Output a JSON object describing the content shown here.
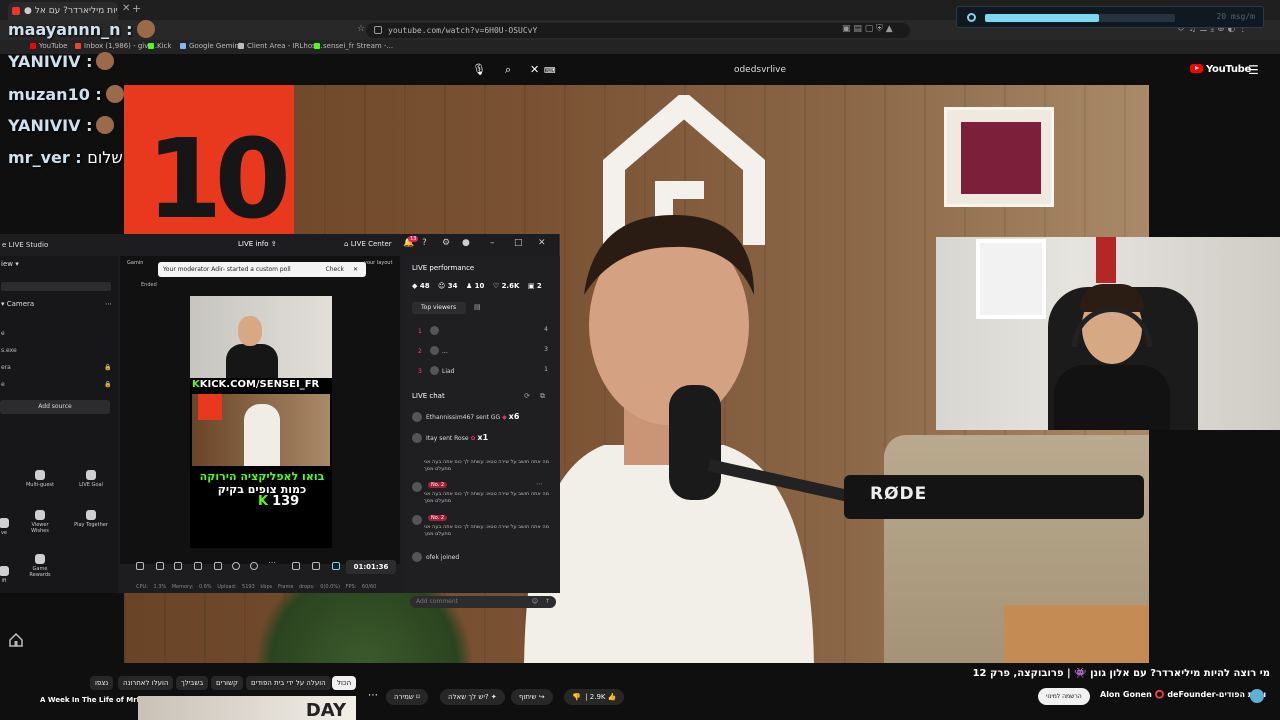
{
  "browser": {
    "tab_title": "● מי רוצה להיות מיליארדר? עם אל",
    "url": "youtube.com/watch?v=6H0U-OSUCvY",
    "bookmarks": [
      {
        "label": "YouTube",
        "color": "#ff0000"
      },
      {
        "label": "Inbox (1,986) - givo...",
        "color": "#ea4335"
      },
      {
        "label": "Kick",
        "color": "#53fc18"
      },
      {
        "label": "Google Gemini",
        "color": "#8ab4f8"
      },
      {
        "label": "Client Area - IRLhos...",
        "color": "#bbbbbb"
      },
      {
        "label": "sensei_fr Stream -...",
        "color": "#53fc18"
      }
    ]
  },
  "speed_meter": {
    "label": "20 msg/m",
    "fill_fraction": 0.6
  },
  "youtube_header": {
    "search_query": "odedsvrlive",
    "logo": "YouTube"
  },
  "chat_overlay": [
    {
      "user": "maayannn_n :",
      "message": "",
      "color": "#cfe0ee"
    },
    {
      "user": "YANIVIV :",
      "message": "",
      "color": "#cfe0ee"
    },
    {
      "user": "muzan10 :",
      "message": "",
      "color": "#cfe0ee"
    },
    {
      "user": "YANIVIV :",
      "message": "",
      "color": "#cfe0ee"
    },
    {
      "user": "mr_ver :",
      "message": "שלום",
      "color": "#cfe0ee"
    }
  ],
  "video": {
    "jersey_number": "10",
    "mic_brand": "RØDE"
  },
  "studio": {
    "title": "e LIVE Studio",
    "center_title": "LIVE info",
    "live_center": "LIVE Center",
    "notif_count": "13",
    "left_header": "iew",
    "camera_header": "Camera",
    "source_rows": [
      "e",
      "s.exe",
      "era",
      "e"
    ],
    "add_source": "Add source",
    "tools": [
      {
        "label": "Multi-guest"
      },
      {
        "label": "LIVE Goal"
      },
      {
        "label": "ve"
      },
      {
        "label": "Viewer Wishes"
      },
      {
        "label": "Play Together"
      },
      {
        "label": "ift"
      },
      {
        "label": "Game Rewards"
      }
    ],
    "gaming": "Gamin",
    "ended": "Ended",
    "layout": "your layout",
    "poll_banner": "Your moderator Adir- started a custom poll",
    "poll_check": "Check",
    "kick_text": "KICK.COM/SENSEI_FR",
    "promo_green": "בואו לאפליקציה הירוקה",
    "promo_white": "כמות צופים בקיק",
    "promo_count": "139",
    "timer": "01:01:36",
    "stats": "CPU: 1.3%  Memory: 0.6%  Upload: 5193 kbps  Frame drops: 0(0.0%)  FPS: 60/60",
    "performance_title": "LIVE performance",
    "performance_stats": [
      "48",
      "34",
      "10",
      "2.6K",
      "2"
    ],
    "top_viewers_tab": "Top viewers",
    "top_viewers": [
      {
        "rank": "1",
        "name": "",
        "score": "4"
      },
      {
        "rank": "2",
        "name": "...",
        "score": "3"
      },
      {
        "rank": "3",
        "name": "Liad",
        "score": "1"
      }
    ],
    "chat_title": "LIVE chat",
    "chat_gifts": [
      {
        "text": "Ethannissim467 sent GG",
        "mult": "x6"
      },
      {
        "text": "Itay sent Rose",
        "mult": "x1"
      }
    ],
    "chat_messages": [
      {
        "tag": "",
        "text": "מה אתה חושב על שירה טטא: עשתה לך כוס אתה בעה אני מתעלם ממך"
      },
      {
        "tag": "No. 2",
        "text": "מה אתה חושב על שירה טטא: עשתה לך כוס אתה בעה אני מתעלם ממך"
      },
      {
        "tag": "No. 2",
        "text": "מה אתה חושב על שירה טטא: עשתה לך כוס אתה בעה אני מתעלם ממך"
      }
    ],
    "joined_line": "ofek joined",
    "add_comment": "Add comment"
  },
  "yt_info": {
    "title": "מי רוצה להיות מיליארדר? עם אלון גונן 👾 | פרובוקצה, פרק 12",
    "channel": "Alon Gonen ⭕ deFounder-ו בית הפודים",
    "join": "הרשמה למינוי",
    "likes": "2.9K",
    "share": "שיתוף",
    "ask": "יש לך שאלה?",
    "save": "שמירה",
    "chips": [
      {
        "label": "הכול",
        "active": true
      },
      {
        "label": "הועלה על ידי בית הפודים",
        "active": false
      },
      {
        "label": "קשורים",
        "active": false
      },
      {
        "label": "בשבילך",
        "active": false
      },
      {
        "label": "הועלו לאחרונה",
        "active": false
      },
      {
        "label": "נצפו",
        "active": false
      }
    ],
    "suggested_title": "A Week In The Life of MrBeast",
    "suggested_thumb_text": "DAY"
  }
}
